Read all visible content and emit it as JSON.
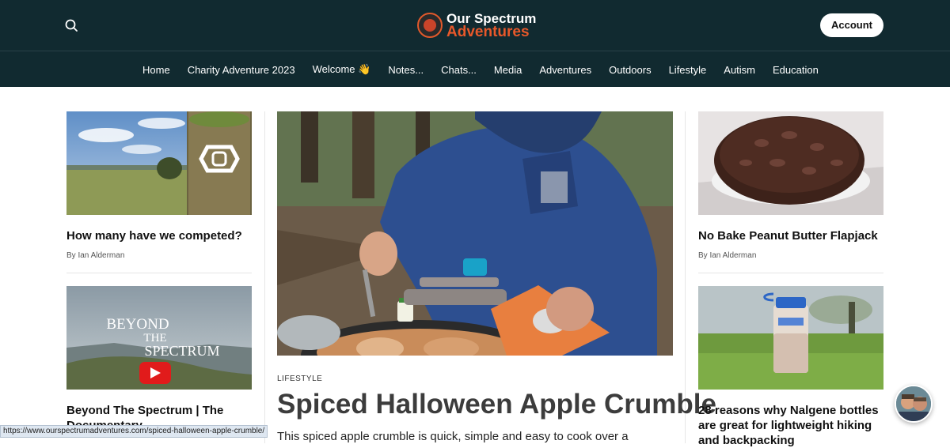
{
  "header": {
    "logo_line1": "Our Spectrum",
    "logo_line2": "Adventures",
    "account_label": "Account",
    "brand_color": "#e8582a",
    "header_bg": "#112a30"
  },
  "nav": {
    "items": [
      {
        "label": "Home"
      },
      {
        "label": "Charity Adventure 2023"
      },
      {
        "label": "Welcome 👋"
      },
      {
        "label": "Notes..."
      },
      {
        "label": "Chats..."
      },
      {
        "label": "Media"
      },
      {
        "label": "Adventures"
      },
      {
        "label": "Outdoors"
      },
      {
        "label": "Lifestyle"
      },
      {
        "label": "Autism"
      },
      {
        "label": "Education"
      }
    ]
  },
  "left_posts": [
    {
      "title": "How many have we competed?",
      "byline": "By Ian Alderman"
    },
    {
      "title": "Beyond The Spectrum | The Documentary",
      "image_text": [
        "BEYOND",
        "THE",
        "SPECTRUM"
      ]
    }
  ],
  "feature": {
    "category": "LIFESTYLE",
    "title": "Spiced Halloween Apple Crumble",
    "excerpt": "This spiced apple crumble is quick, simple and easy to cook over a"
  },
  "right_posts": [
    {
      "title": "No Bake Peanut Butter Flapjack",
      "byline": "By Ian Alderman"
    },
    {
      "title": "28 reasons why Nalgene bottles are great for lightweight hiking and backpacking"
    }
  ],
  "status_bar": {
    "url": "https://www.ourspectrumadventures.com/spiced-halloween-apple-crumble/"
  }
}
